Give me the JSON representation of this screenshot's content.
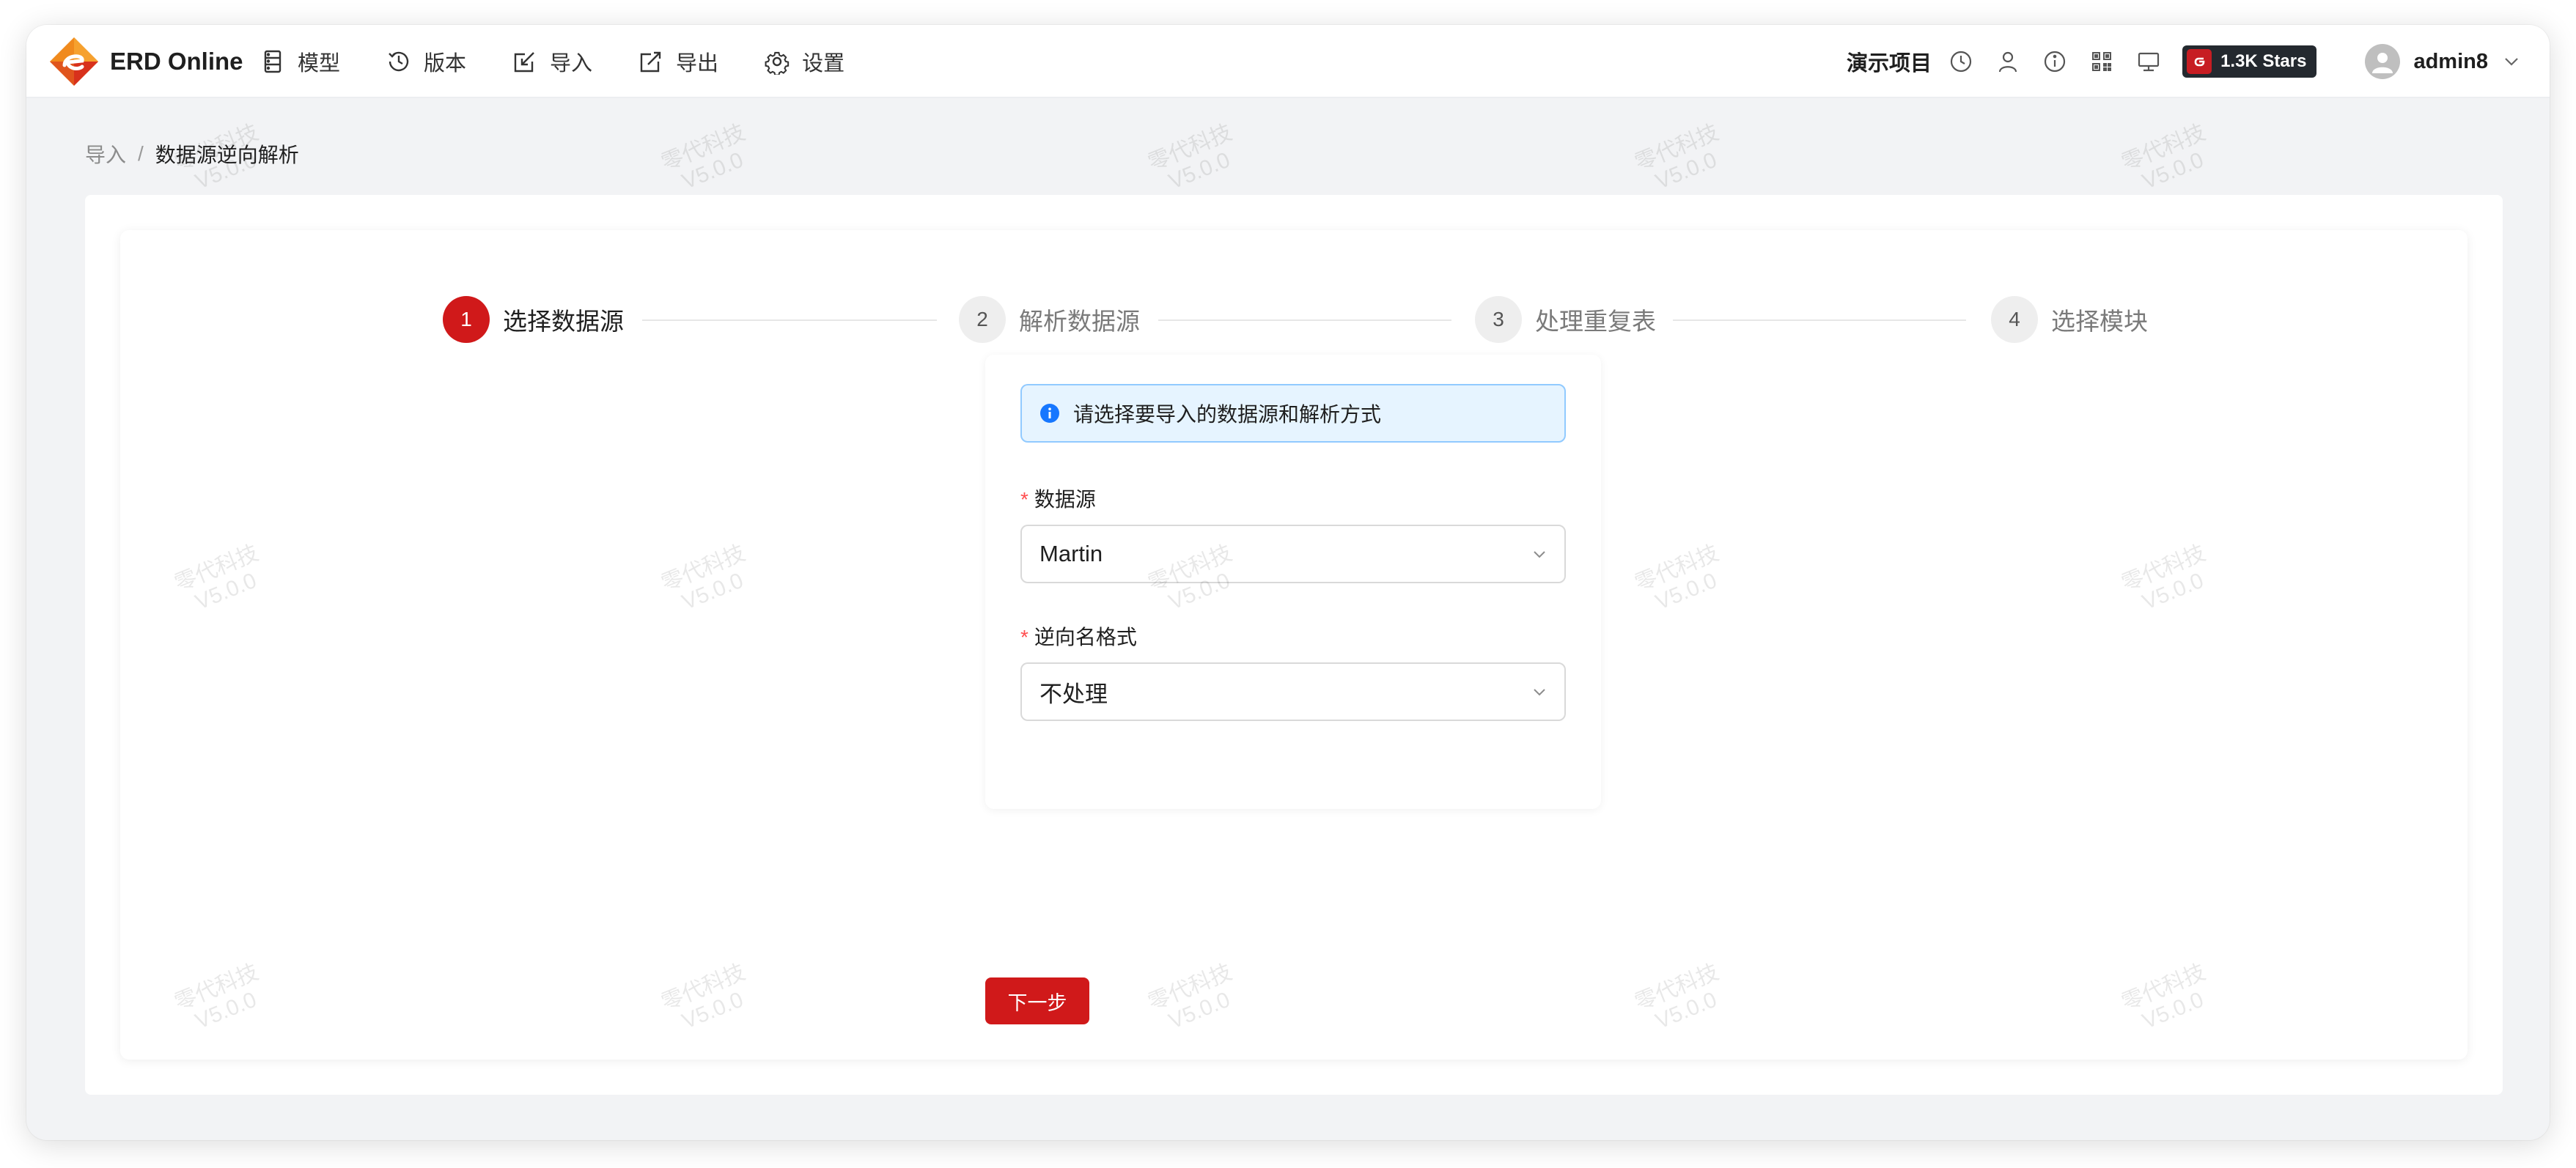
{
  "app": {
    "name": "ERD Online"
  },
  "nav": [
    {
      "label": "模型",
      "icon": "model-icon"
    },
    {
      "label": "版本",
      "icon": "history-icon"
    },
    {
      "label": "导入",
      "icon": "import-icon"
    },
    {
      "label": "导出",
      "icon": "export-icon"
    },
    {
      "label": "设置",
      "icon": "gear-icon"
    }
  ],
  "header": {
    "project": "演示项目",
    "github_stars": "1.3K Stars",
    "username": "admin8"
  },
  "breadcrumb": {
    "parent": "导入",
    "separator": "/",
    "current": "数据源逆向解析"
  },
  "steps": [
    {
      "number": "1",
      "label": "选择数据源",
      "status": "active"
    },
    {
      "number": "2",
      "label": "解析数据源",
      "status": "wait"
    },
    {
      "number": "3",
      "label": "处理重复表",
      "status": "wait"
    },
    {
      "number": "4",
      "label": "选择模块",
      "status": "wait"
    }
  ],
  "form": {
    "alert": "请选择要导入的数据源和解析方式",
    "datasource": {
      "label": "数据源",
      "value": "Martin"
    },
    "naming": {
      "label": "逆向名格式",
      "value": "不处理"
    },
    "required_mark": "*"
  },
  "actions": {
    "next": "下一步"
  },
  "watermark": {
    "line1": "零代科技",
    "line2": "V5.0.0"
  },
  "colors": {
    "primary": "#d0191a",
    "info_bg": "#e6f4ff",
    "info_border": "#91caff"
  }
}
